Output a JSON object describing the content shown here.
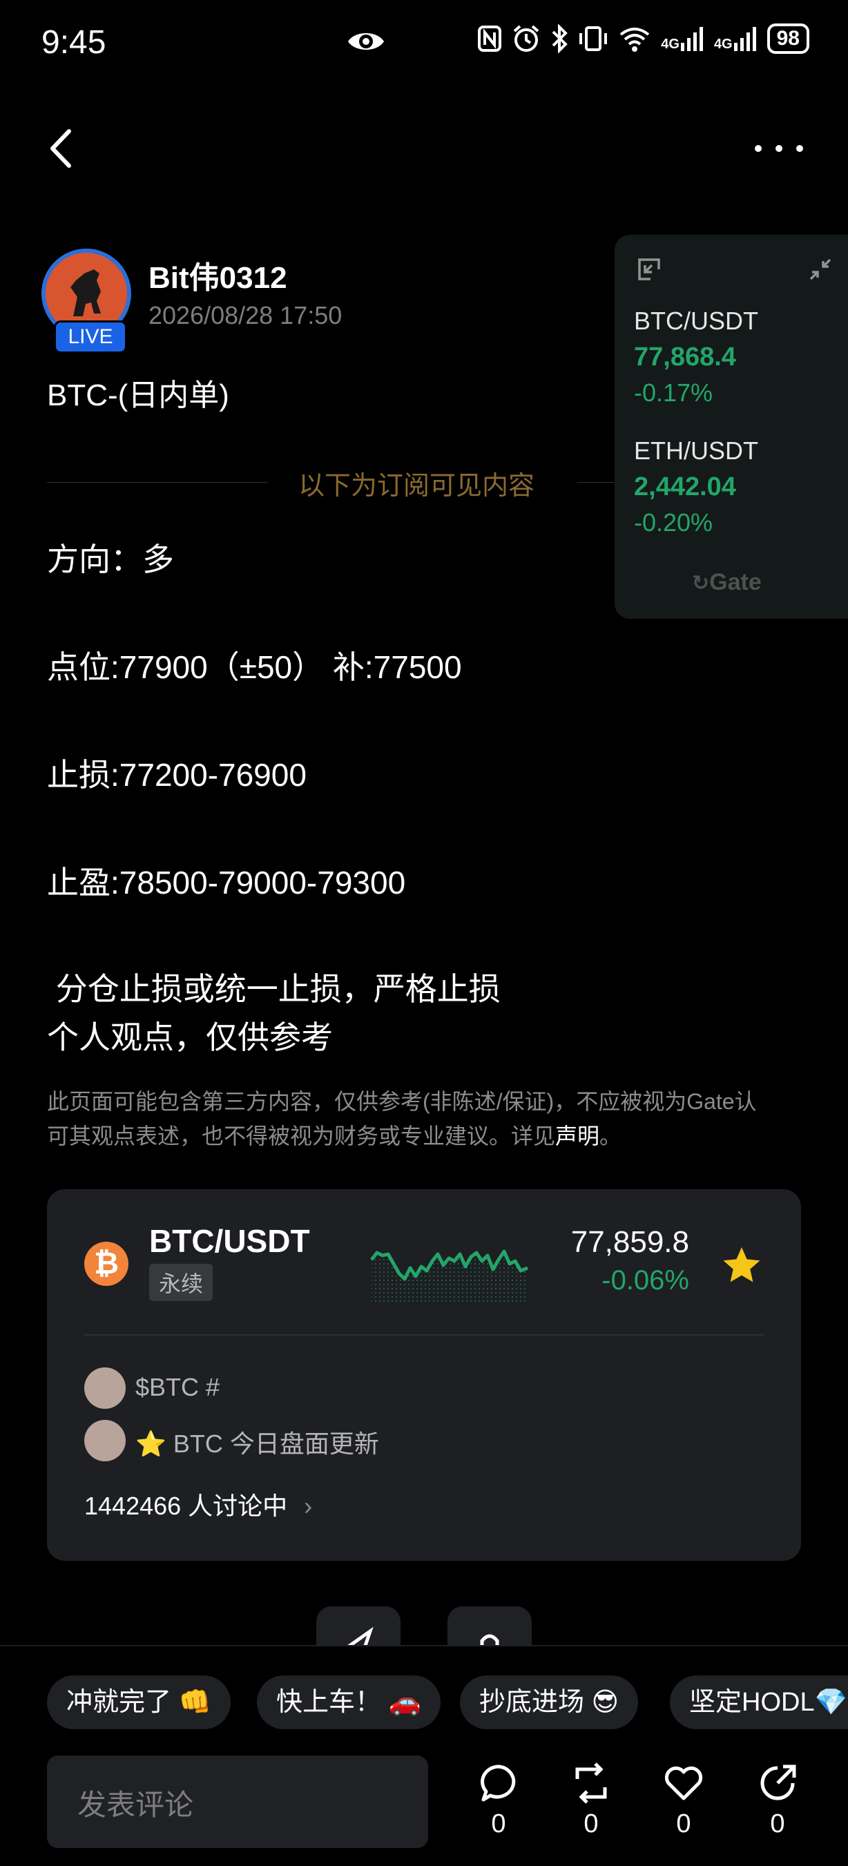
{
  "status_bar": {
    "time": "9:45",
    "battery": "98",
    "icons": [
      "eye-icon",
      "nfc-icon",
      "alarm-icon",
      "bluetooth-icon",
      "vibrate-icon",
      "wifi-icon",
      "signal-4g-icon",
      "signal-4g-icon"
    ],
    "network_label_1": "4G",
    "network_label_2": "4G"
  },
  "nav": {
    "back_icon": "chevron-left-icon",
    "more_icon": "more-dots-icon"
  },
  "author": {
    "name": "Bit伟0312",
    "time": "2026/08/28 17:50",
    "live_badge": "LIVE"
  },
  "post": {
    "title": "BTC-(日内单)",
    "subscriber_divider": "以下为订阅可见内容",
    "lines": [
      "方向：多",
      "点位:77900（±50） 补:77500",
      "止损:77200-76900",
      "止盈:78500-79000-79300",
      " 分仓止损或统一止损，严格止损",
      "个人观点，仅供参考"
    ],
    "disclaimer_1": "此页面可能包含第三方内容，仅供参考(非陈述/保证)，不应被视为Gate认",
    "disclaimer_2": "可其观点表述，也不得被视为财务或专业建议。详见",
    "disclaimer_link": "声明",
    "disclaimer_end": "。"
  },
  "ticker_widget": {
    "items": [
      {
        "pair": "BTC/USDT",
        "price": "77,868.4",
        "change": "-0.17%"
      },
      {
        "pair": "ETH/USDT",
        "price": "2,442.04",
        "change": "-0.20%"
      }
    ],
    "logo": "Gate"
  },
  "market_card": {
    "pair": "BTC/USDT",
    "type_tag": "永续",
    "price": "77,859.8",
    "change": "-0.06%",
    "topics": [
      {
        "text": "$BTC #"
      },
      {
        "text": "⭐ BTC 今日盘面更新"
      }
    ],
    "discussion": "1442466 人讨论中"
  },
  "bottom_bar": {
    "chips": [
      "冲就完了 👊",
      "快上车！ 🚗",
      "抄底进场 😎",
      "坚定HODL💎"
    ],
    "comment_placeholder": "发表评论",
    "actions": [
      {
        "icon": "comment-icon",
        "count": "0"
      },
      {
        "icon": "repost-icon",
        "count": "0"
      },
      {
        "icon": "heart-icon",
        "count": "0"
      },
      {
        "icon": "share-icon",
        "count": "0"
      }
    ]
  },
  "colors": {
    "positive": "#22a66a",
    "accent_blue": "#1a63e6",
    "btc_orange": "#f2853b",
    "star": "#f5c518"
  }
}
